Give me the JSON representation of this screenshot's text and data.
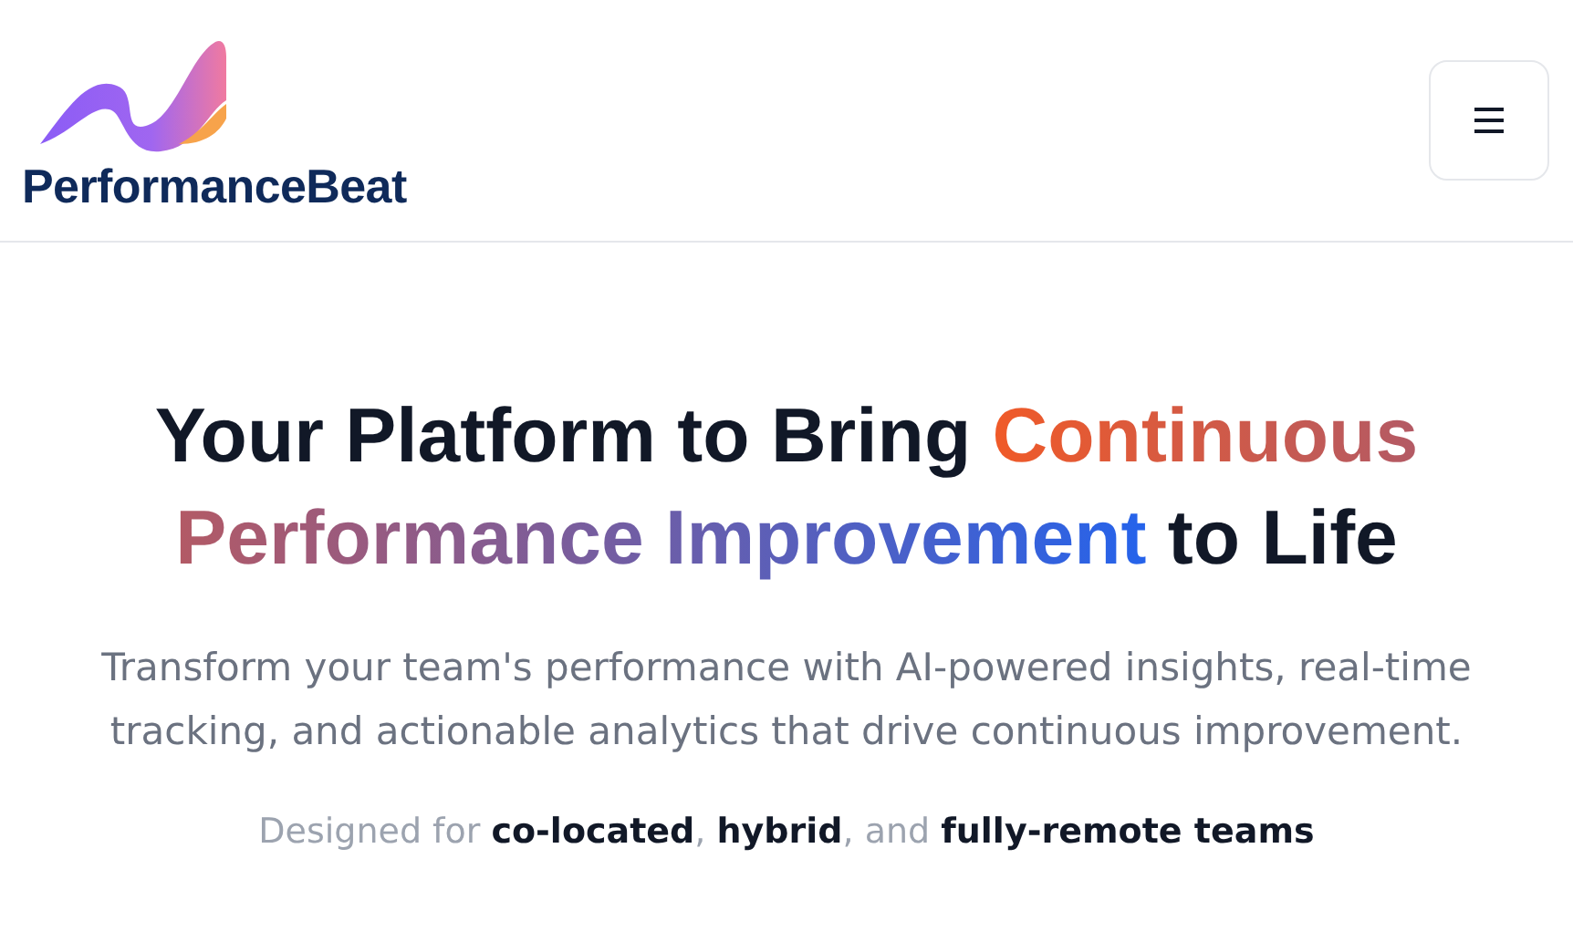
{
  "header": {
    "logo_text": "PerformanceBeat"
  },
  "hero": {
    "headline": [
      {
        "text": "Your Platform to Bring ",
        "kind": "plain"
      },
      {
        "text": "Continuous Performance Improvement",
        "kind": "gradient"
      },
      {
        "text": " to Life",
        "kind": "plain"
      }
    ],
    "subtitle": "Transform your team's performance with AI-powered insights, real-time tracking, and actionable analytics that drive continuous improvement.",
    "tagline": "Designed for **co-located**, **hybrid**, and **fully-remote teams**"
  }
}
